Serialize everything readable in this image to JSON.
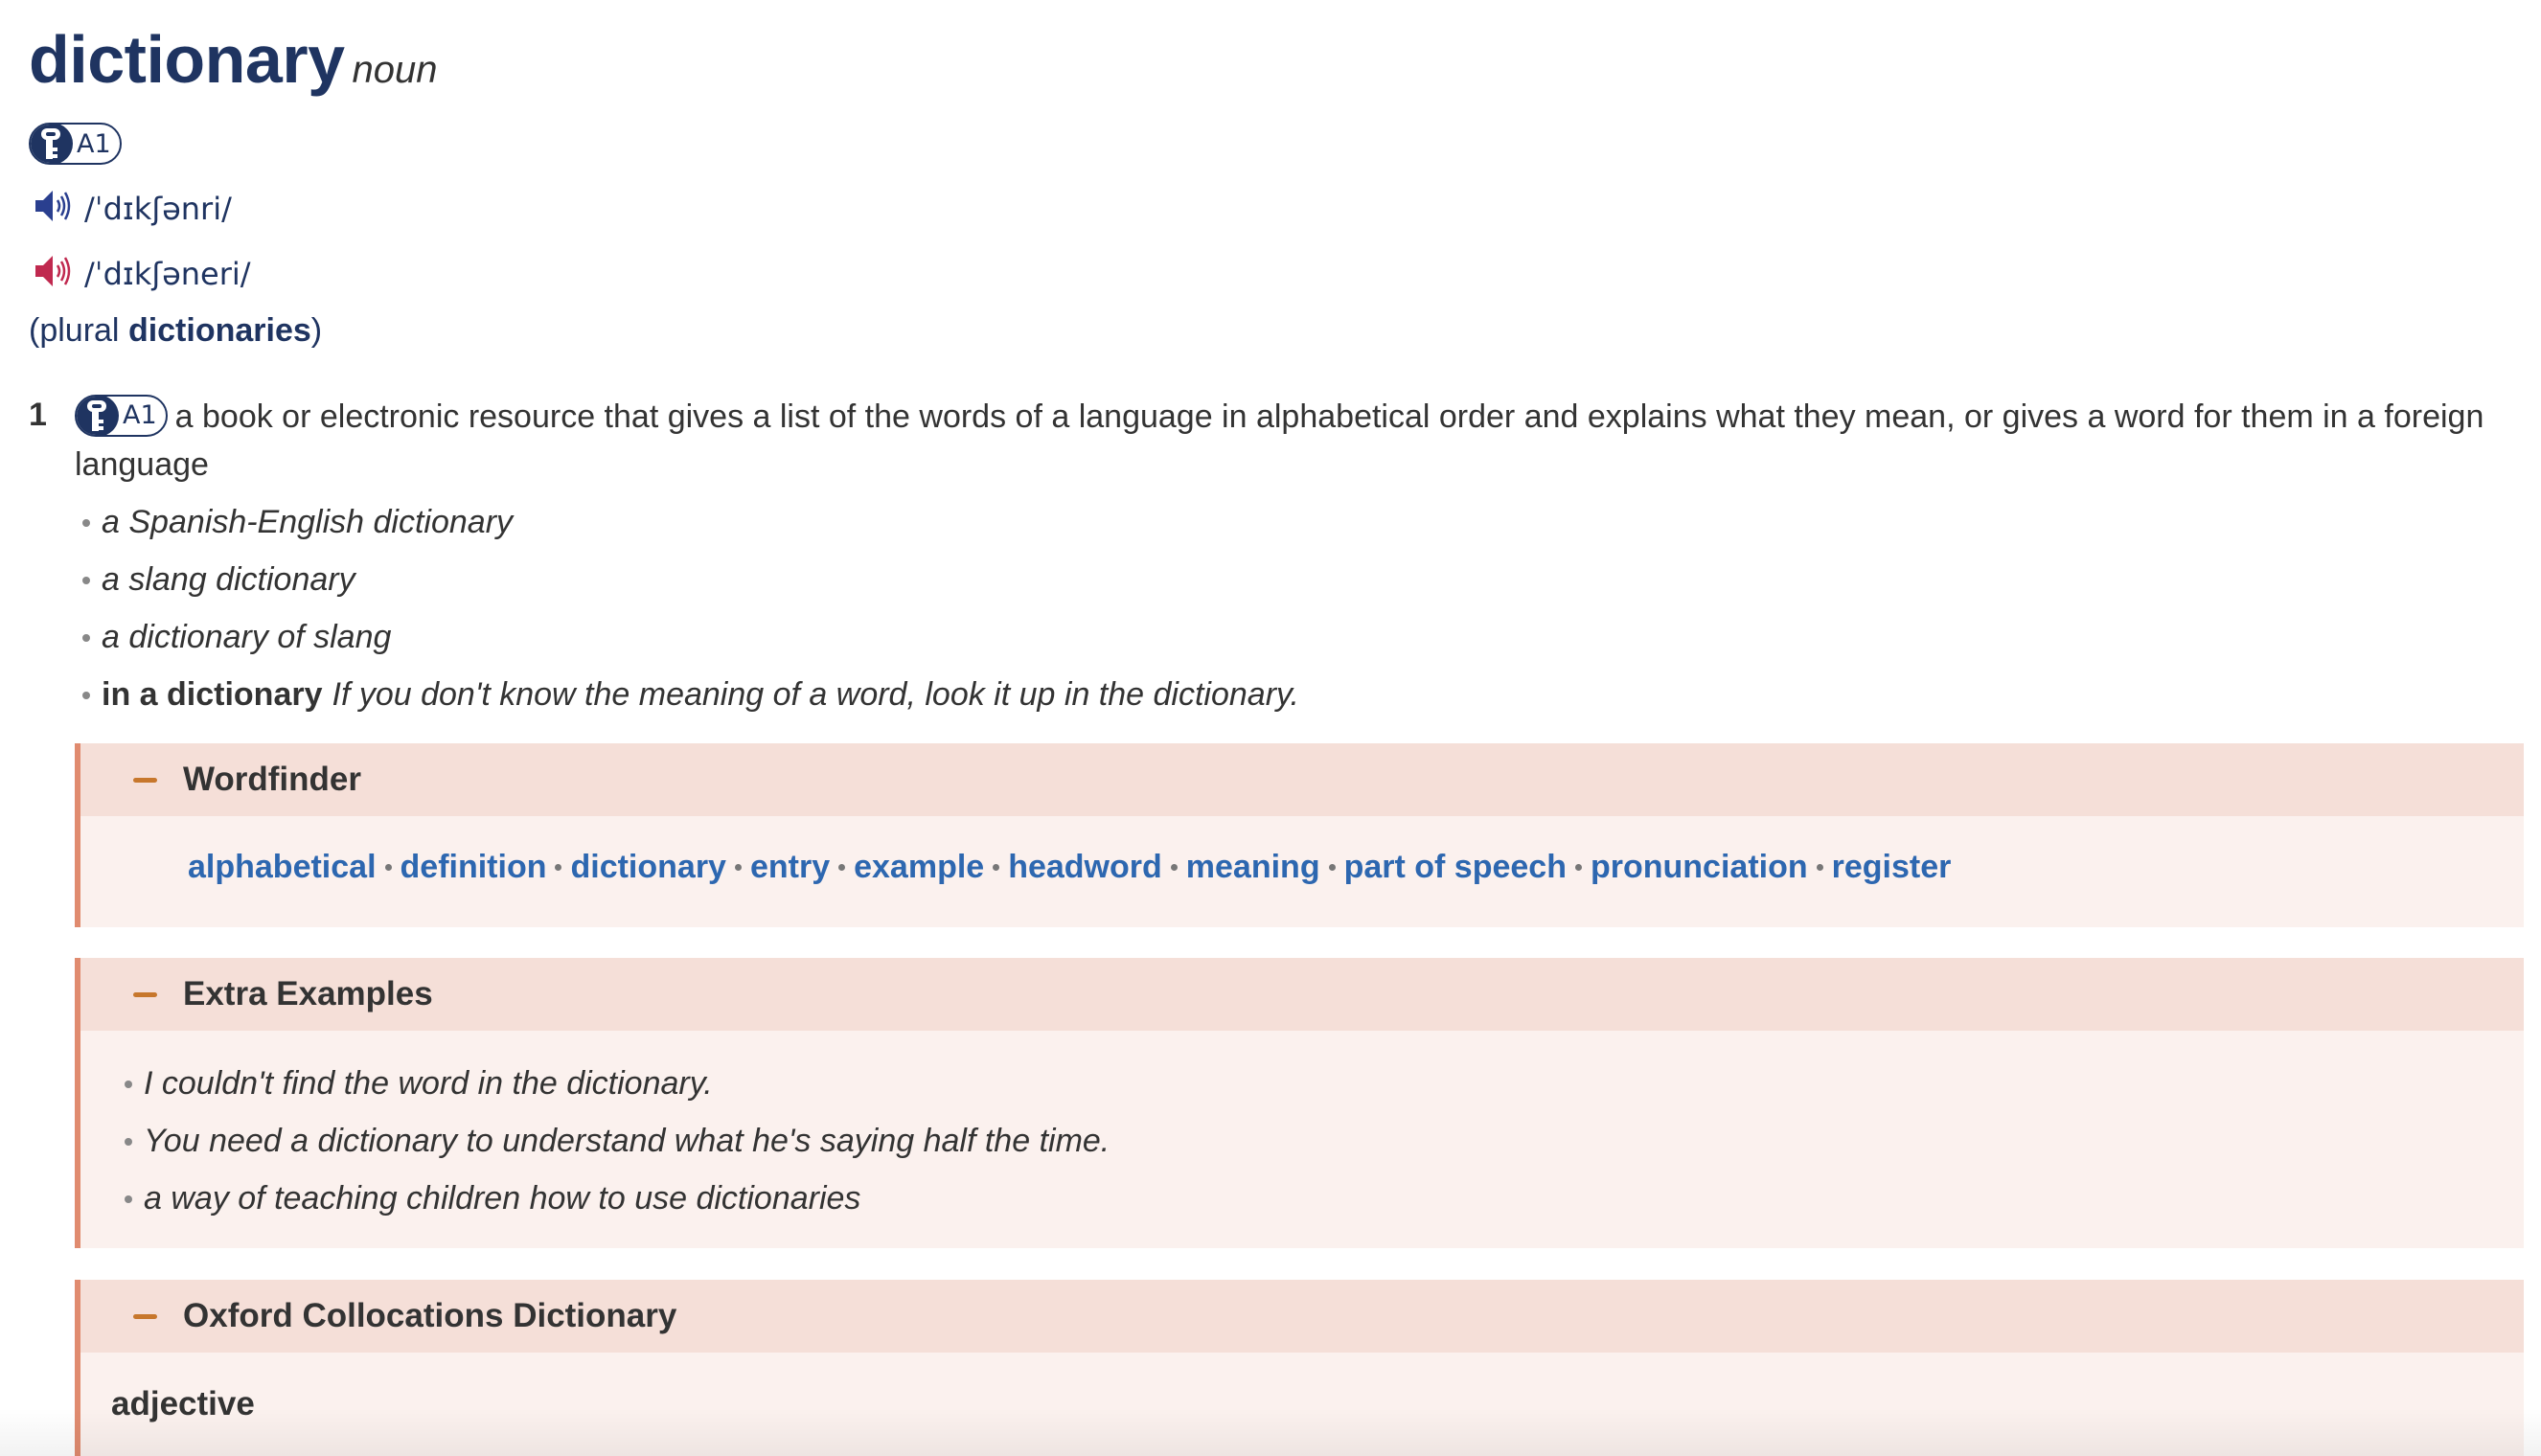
{
  "entry": {
    "headword": "dictionary",
    "part_of_speech": "noun",
    "cefr_level": "A1",
    "pronunciations": [
      {
        "region": "uk",
        "icon": "speaker-icon",
        "color": "#2a3f8f",
        "phonetic": "/ˈdɪkʃənri/"
      },
      {
        "region": "us",
        "icon": "speaker-icon",
        "color": "#c0294f",
        "phonetic": "/ˈdɪkʃəneri/"
      }
    ],
    "inflections": {
      "prefix": "(plural ",
      "form": "dictionaries",
      "suffix": ")"
    }
  },
  "senses": [
    {
      "number": "1",
      "cefr_level": "A1",
      "definition": "a book or electronic resource that gives a list of the words of a language in alphabetical order and explains what they mean, or gives a word for them in a foreign language",
      "examples": [
        {
          "cf": "",
          "text": "a Spanish-English dictionary"
        },
        {
          "cf": "",
          "text": "a slang dictionary"
        },
        {
          "cf": "",
          "text": "a dictionary of slang"
        },
        {
          "cf": "in a dictionary",
          "text": "If you don't know the meaning of a word, look it up in the dictionary."
        }
      ]
    }
  ],
  "wordfinder": {
    "title": "Wordfinder",
    "links": [
      "alphabetical",
      "definition",
      "dictionary",
      "entry",
      "example",
      "headword",
      "meaning",
      "part of speech",
      "pronunciation",
      "register"
    ]
  },
  "extra_examples": {
    "title": "Extra Examples",
    "items": [
      "I couldn't find the word in the dictionary.",
      "You need a dictionary to understand what he's saying half the time.",
      "a way of teaching children how to use dictionaries"
    ]
  },
  "collocations": {
    "title": "Oxford Collocations Dictionary",
    "first_heading": "adjective"
  },
  "colors": {
    "headword": "#1f3461",
    "link": "#2d67b0",
    "box_border": "#e08b6f",
    "box_header": "#f5dfd8",
    "box_body": "#fbf1ee",
    "toggle": "#c7772c"
  }
}
